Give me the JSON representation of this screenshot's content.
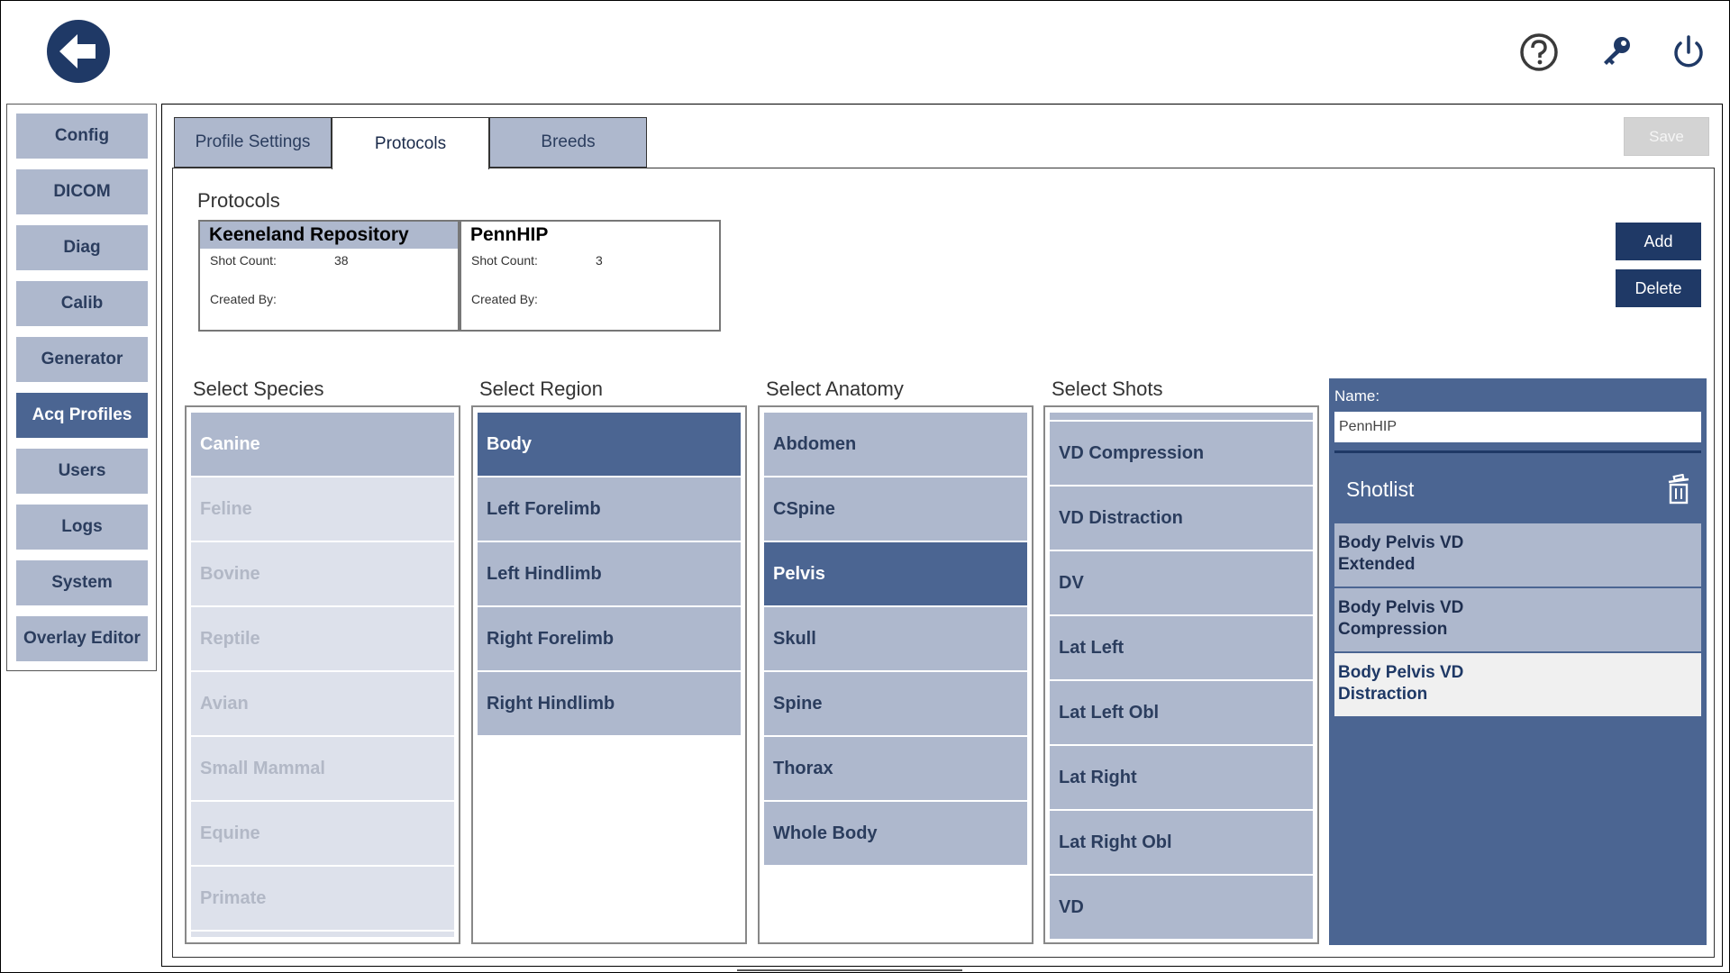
{
  "nav": {
    "items": [
      {
        "label": "Config"
      },
      {
        "label": "DICOM"
      },
      {
        "label": "Diag"
      },
      {
        "label": "Calib"
      },
      {
        "label": "Generator"
      },
      {
        "label": "Acq Profiles",
        "active": true
      },
      {
        "label": "Users"
      },
      {
        "label": "Logs"
      },
      {
        "label": "System"
      },
      {
        "label": "Overlay Editor"
      }
    ]
  },
  "tabs": [
    {
      "label": "Profile Settings"
    },
    {
      "label": "Protocols",
      "active": true
    },
    {
      "label": "Breeds"
    }
  ],
  "toolbar": {
    "save_label": "Save"
  },
  "protocols": {
    "heading": "Protocols",
    "cards": [
      {
        "name": "Keeneland Repository",
        "shot_count_label": "Shot Count:",
        "shot_count": "38",
        "created_by_label": "Created By:",
        "selected": true
      },
      {
        "name": "PennHIP",
        "shot_count_label": "Shot Count:",
        "shot_count": "3",
        "created_by_label": "Created By:"
      }
    ],
    "add_label": "Add",
    "delete_label": "Delete"
  },
  "species": {
    "heading": "Select Species",
    "items": [
      "Canine",
      "Feline",
      "Bovine",
      "Reptile",
      "Avian",
      "Small Mammal",
      "Equine",
      "Primate"
    ]
  },
  "region": {
    "heading": "Select Region",
    "items": [
      "Body",
      "Left Forelimb",
      "Left Hindlimb",
      "Right Forelimb",
      "Right Hindlimb"
    ],
    "selected": "Body"
  },
  "anatomy": {
    "heading": "Select Anatomy",
    "items": [
      "Abdomen",
      "CSpine",
      "Pelvis",
      "Skull",
      "Spine",
      "Thorax",
      "Whole Body"
    ],
    "selected": "Pelvis"
  },
  "shots": {
    "heading": "Select Shots",
    "items": [
      "VD Compression",
      "VD Distraction",
      "DV",
      "Lat Left",
      "Lat Left Obl",
      "Lat Right",
      "Lat Right Obl",
      "VD"
    ]
  },
  "detail": {
    "name_label": "Name:",
    "name_value": "PennHIP",
    "shotlist_title": "Shotlist",
    "shotlist": [
      {
        "line1": "Body Pelvis VD",
        "line2": "Extended"
      },
      {
        "line1": "Body Pelvis VD",
        "line2": "Compression"
      },
      {
        "line1": "Body Pelvis VD",
        "line2": "Distraction",
        "selected": true
      }
    ]
  },
  "colors": {
    "accent_dark": "#1f3966",
    "accent_mid": "#4b6592",
    "item_bg": "#aeb8cd"
  },
  "icons": [
    "back-arrow-icon",
    "help-icon",
    "key-icon",
    "power-icon",
    "trash-icon"
  ]
}
